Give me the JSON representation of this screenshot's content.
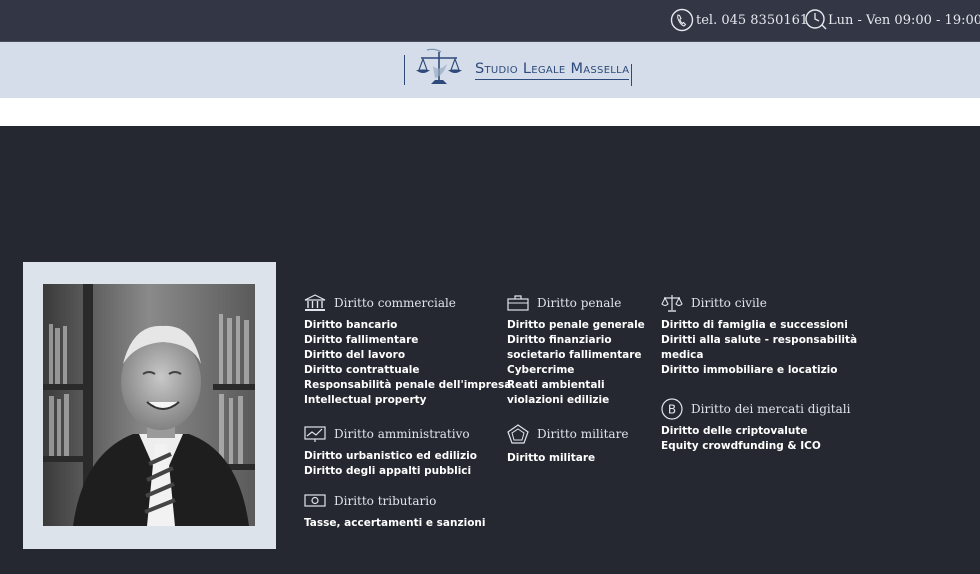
{
  "topbar": {
    "phone": "tel. 045 8350161",
    "hours": "Lun - Ven 09:00 - 19:00",
    "phone_icon": "phone-icon",
    "clock_icon": "clock-icon"
  },
  "logo": {
    "name": "Studio Legale Massella",
    "icon": "scales-of-justice-logo"
  },
  "colors": {
    "topbar_bg": "#333745",
    "logo_band_bg": "#d4dde9",
    "brand_blue": "#2e4a7a",
    "main_bg": "#252830"
  },
  "areas": {
    "commerciale": {
      "title": "Diritto commerciale",
      "icon": "bank-icon",
      "items": [
        "Diritto bancario",
        "Diritto fallimentare",
        "Diritto del lavoro",
        "Diritto contrattuale",
        "Responsabilità penale dell'impresa",
        "Intellectual property"
      ]
    },
    "amministrativo": {
      "title": "Diritto amministrativo",
      "icon": "presentation-chart-icon",
      "items": [
        "Diritto urbanistico ed edilizio",
        "Diritto degli appalti pubblici"
      ]
    },
    "tributario": {
      "title": "Diritto tributario",
      "icon": "banknote-icon",
      "items": [
        "Tasse, accertamenti e sanzioni"
      ]
    },
    "penale": {
      "title": "Diritto penale",
      "icon": "briefcase-icon",
      "items": [
        "Diritto penale generale",
        "Diritto finanziario",
        "societario fallimentare",
        "Cybercrime",
        "Reati ambientali",
        "violazioni edilizie"
      ]
    },
    "militare": {
      "title": "Diritto militare",
      "icon": "pentagon-icon",
      "items": [
        "Diritto militare"
      ]
    },
    "civile": {
      "title": "Diritto civile",
      "icon": "scales-icon",
      "items": [
        "Diritto di famiglia e successioni",
        "Diritti alla salute - responsabilità",
        "medica",
        "Diritto immobiliare e locatizio"
      ]
    },
    "digitali": {
      "title": "Diritto dei mercati digitali",
      "icon": "bitcoin-icon",
      "items": [
        "Diritto delle criptovalute",
        "Equity crowdfunding & ICO"
      ]
    }
  }
}
